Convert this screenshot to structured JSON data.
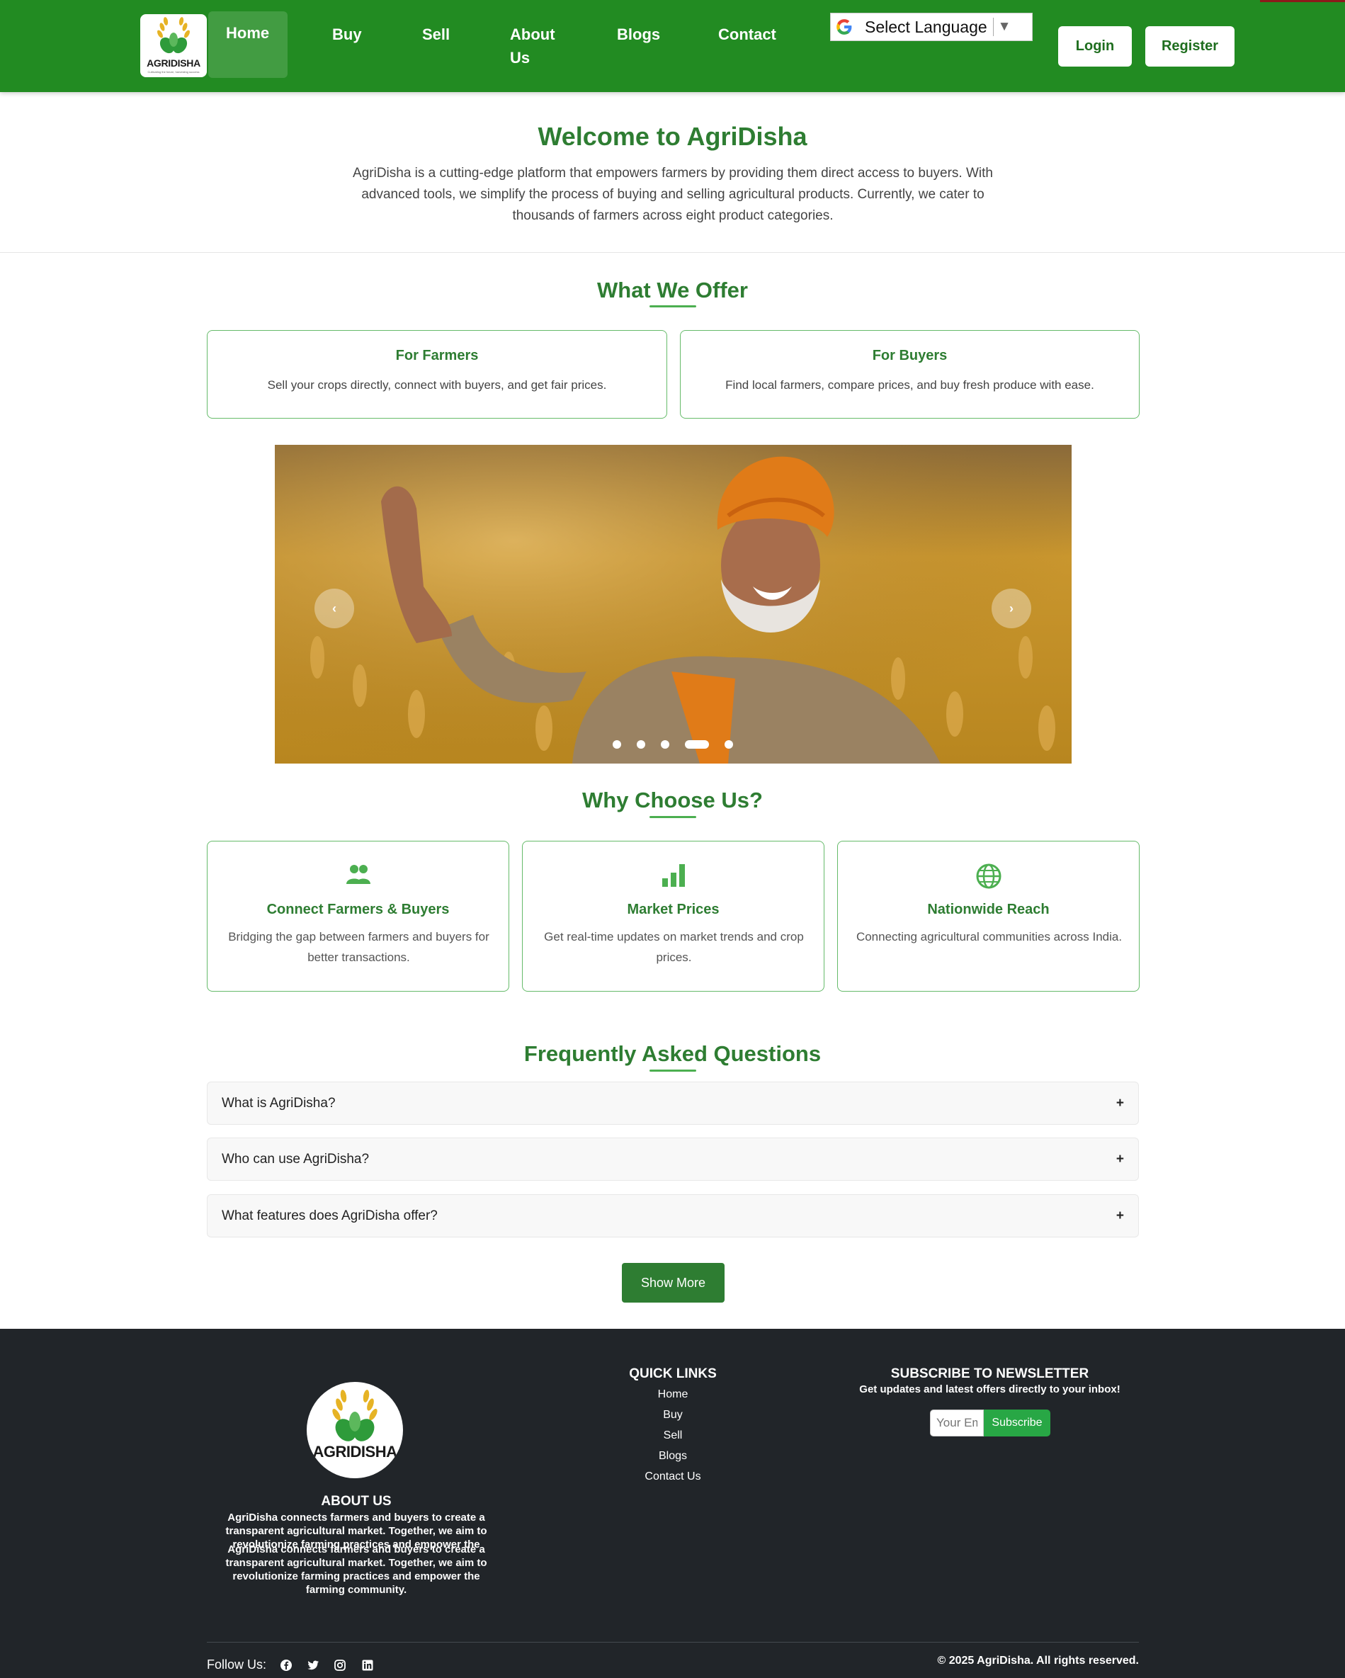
{
  "nav": {
    "logo_text": "AGRIDISHA",
    "logo_tagline": "Cultivating the future, harvesting success",
    "links": [
      "Home",
      "Buy",
      "Sell",
      "About Us",
      "Blogs",
      "Contact"
    ],
    "about_line1": "About",
    "about_line2": "Us",
    "language": "Select Language",
    "login": "Login",
    "register": "Register"
  },
  "welcome": {
    "title": "Welcome to AgriDisha",
    "text": "AgriDisha is a cutting-edge platform that empowers farmers by providing them direct access to buyers. With advanced tools, we simplify the process of buying and selling agricultural products. Currently, we cater to thousands of farmers across eight product categories."
  },
  "offer": {
    "title": "What We Offer",
    "cards": [
      {
        "title": "For Farmers",
        "text": "Sell your crops directly, connect with buyers, and get fair prices."
      },
      {
        "title": "For Buyers",
        "text": "Find local farmers, compare prices, and buy fresh produce with ease."
      }
    ]
  },
  "carousel": {
    "prev": "‹",
    "next": "›",
    "slide_count": 5,
    "active_slide": 4
  },
  "why": {
    "title": "Why Choose Us?",
    "cards": [
      {
        "icon": "users-icon",
        "title": "Connect Farmers & Buyers",
        "text": "Bridging the gap between farmers and buyers for better transactions."
      },
      {
        "icon": "bar-chart-icon",
        "title": "Market Prices",
        "text": "Get real-time updates on market trends and crop prices."
      },
      {
        "icon": "globe-icon",
        "title": "Nationwide Reach",
        "text": "Connecting agricultural communities across India."
      }
    ]
  },
  "faq": {
    "title": "Frequently Asked Questions",
    "items": [
      {
        "q": "What is AgriDisha?",
        "toggle": "+"
      },
      {
        "q": "Who can use AgriDisha?",
        "toggle": "+"
      },
      {
        "q": "What features does AgriDisha offer?",
        "toggle": "+"
      }
    ],
    "show_more": "Show More"
  },
  "footer": {
    "logo_text": "AGRIDISHA",
    "about_title": "ABOUT US",
    "about_text": "AgriDisha connects farmers and buyers to create a transparent agricultural market. Together, we aim to revolutionize farming practices and empower the",
    "about_text_repeat": "AgriDisha connects farmers and buyers to create a transparent agricultural market. Together, we aim to revolutionize farming practices and empower the farming community.",
    "quick_links_title": "QUICK LINKS",
    "quick_links": [
      "Home",
      "Buy",
      "Sell",
      "Blogs",
      "Contact Us"
    ],
    "newsletter_title": "SUBSCRIBE TO NEWSLETTER",
    "newsletter_text": "Get updates and latest offers directly to your inbox!",
    "email_placeholder": "Your Email",
    "subscribe": "Subscribe",
    "follow": "Follow Us:",
    "social": [
      "facebook-icon",
      "twitter-icon",
      "instagram-icon",
      "linkedin-icon"
    ],
    "copyright": "© 2025 AgriDisha. All rights reserved."
  },
  "colors": {
    "nav_green": "#228b22",
    "title_green": "#2e7d32",
    "card_border": "#66bb6a",
    "footer_bg": "#212529",
    "subscribe_green": "#28a745"
  }
}
